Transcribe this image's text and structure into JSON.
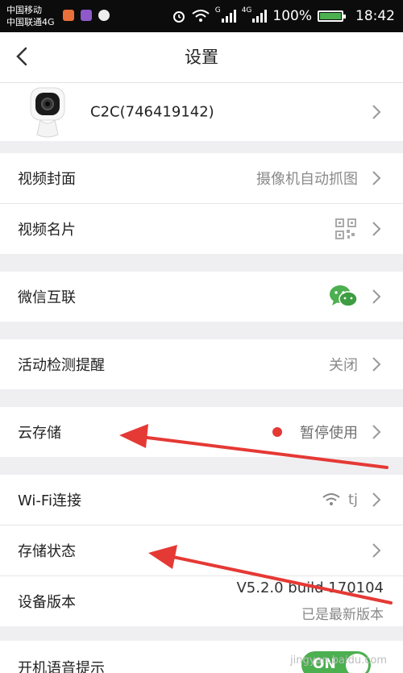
{
  "status_bar": {
    "carrier_1": "中国移动",
    "carrier_2": "中国联通4G",
    "network_1": "G",
    "network_2": "4G",
    "battery": "100%",
    "time": "18:42",
    "battery_level_percent": 100
  },
  "header": {
    "title": "设置",
    "back_icon": "chevron-left-icon"
  },
  "device": {
    "name": "C2C(746419142)",
    "icon": "camera-icon"
  },
  "settings": [
    {
      "label": "视频封面",
      "value": "摄像机自动抓图"
    },
    {
      "label": "视频名片",
      "icon": "qr-code-icon"
    },
    {
      "label": "微信互联",
      "icon": "wechat-icon"
    },
    {
      "label": "活动检测提醒",
      "value": "关闭"
    },
    {
      "label": "云存储",
      "value": "暂停使用",
      "status_color": "#e53935"
    },
    {
      "label": "Wi-Fi连接",
      "value": "tj",
      "icon": "wifi-icon"
    },
    {
      "label": "存储状态"
    },
    {
      "label": "设备版本",
      "value": "V5.2.0 build 170104",
      "sub_value": "已是最新版本"
    },
    {
      "label": "开机语音提示",
      "toggle": "ON",
      "toggle_color": "#4caf50"
    }
  ],
  "annotations": {
    "arrow_color": "#e53935"
  },
  "watermark": "jingyan.baidu.com"
}
